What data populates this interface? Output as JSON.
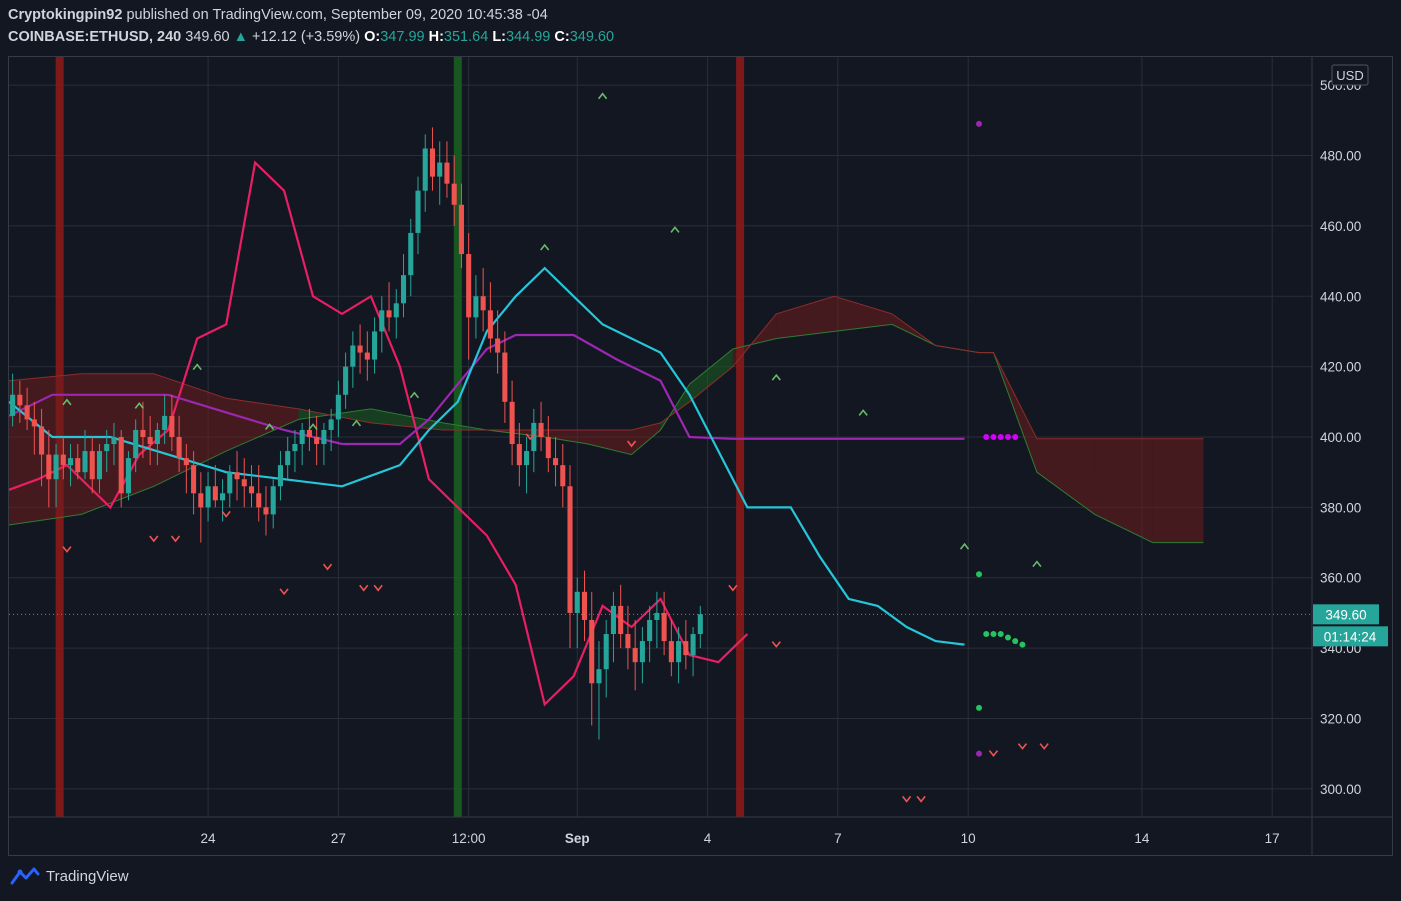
{
  "header": {
    "author": "Cryptokingpin92",
    "published_text": "published on TradingView.com, September 09, 2020 10:45:38 -04",
    "symbol": "COINBASE:ETHUSD, 240",
    "last": "349.60",
    "arrow": "▲",
    "change": "+12.12 (+3.59%)",
    "o_label": "O:",
    "o_value": "347.99",
    "h_label": "H:",
    "h_value": "351.64",
    "l_label": "L:",
    "l_value": "344.99",
    "c_label": "C:",
    "c_value": "349.60"
  },
  "footer": {
    "brand": "TradingView",
    "logo_icon": "tradingview-logo-icon"
  },
  "colors": {
    "background": "#131722",
    "grid": "#2a2e39",
    "up": "#26a69a",
    "down": "#ef5350",
    "tenkan": "#26c6da",
    "kijun": "#9c27b0",
    "chikou": "#e91e63",
    "cloud_bull": "#1b5e20",
    "cloud_bear": "#6d1d1d"
  },
  "chart_data": {
    "type": "candlestick",
    "currency": "USD",
    "y_ticks": [
      "300.00",
      "320.00",
      "340.00",
      "360.00",
      "380.00",
      "400.00",
      "420.00",
      "440.00",
      "460.00",
      "480.00",
      "500.00"
    ],
    "y_range": [
      292,
      508
    ],
    "x_ticks": [
      {
        "label": "24",
        "idx": 27.5
      },
      {
        "label": "27",
        "idx": 45.5
      },
      {
        "label": "12:00",
        "idx": 63.5
      },
      {
        "label": "Sep",
        "idx": 78.5
      },
      {
        "label": "4",
        "idx": 96.5
      },
      {
        "label": "7",
        "idx": 114.5
      },
      {
        "label": "10",
        "idx": 132.5
      },
      {
        "label": "14",
        "idx": 156.5
      },
      {
        "label": "17",
        "idx": 174.5
      }
    ],
    "last_price": {
      "value": 349.6,
      "label": "349.60",
      "countdown": "01:14:24"
    },
    "x_count": 180,
    "candles": [
      [
        406,
        418,
        403,
        412
      ],
      [
        412,
        416,
        404,
        409
      ],
      [
        409,
        414,
        402,
        405
      ],
      [
        405,
        410,
        395,
        403
      ],
      [
        403,
        408,
        386,
        395
      ],
      [
        395,
        402,
        380,
        388
      ],
      [
        388,
        398,
        380,
        395
      ],
      [
        395,
        400,
        388,
        392
      ],
      [
        392,
        398,
        386,
        394
      ],
      [
        394,
        398,
        388,
        390
      ],
      [
        390,
        402,
        388,
        396
      ],
      [
        396,
        400,
        384,
        388
      ],
      [
        388,
        398,
        384,
        396
      ],
      [
        396,
        402,
        390,
        398
      ],
      [
        398,
        404,
        392,
        400
      ],
      [
        400,
        402,
        380,
        384
      ],
      [
        384,
        396,
        382,
        394
      ],
      [
        394,
        405,
        390,
        402
      ],
      [
        402,
        410,
        394,
        400
      ],
      [
        400,
        406,
        392,
        398
      ],
      [
        398,
        404,
        392,
        402
      ],
      [
        402,
        412,
        398,
        406
      ],
      [
        406,
        412,
        396,
        400
      ],
      [
        400,
        406,
        390,
        394
      ],
      [
        394,
        398,
        384,
        392
      ],
      [
        392,
        396,
        378,
        384
      ],
      [
        384,
        390,
        370,
        380
      ],
      [
        380,
        390,
        376,
        386
      ],
      [
        386,
        392,
        380,
        382
      ],
      [
        382,
        388,
        376,
        384
      ],
      [
        384,
        392,
        380,
        390
      ],
      [
        390,
        396,
        382,
        388
      ],
      [
        388,
        394,
        380,
        386
      ],
      [
        386,
        392,
        380,
        384
      ],
      [
        384,
        392,
        376,
        380
      ],
      [
        380,
        386,
        372,
        378
      ],
      [
        378,
        388,
        374,
        386
      ],
      [
        386,
        396,
        382,
        392
      ],
      [
        392,
        400,
        388,
        396
      ],
      [
        396,
        402,
        390,
        398
      ],
      [
        398,
        404,
        392,
        402
      ],
      [
        402,
        408,
        396,
        400
      ],
      [
        400,
        406,
        392,
        398
      ],
      [
        398,
        404,
        392,
        402
      ],
      [
        402,
        408,
        396,
        405
      ],
      [
        405,
        416,
        400,
        412
      ],
      [
        412,
        424,
        408,
        420
      ],
      [
        420,
        430,
        414,
        426
      ],
      [
        426,
        432,
        418,
        424
      ],
      [
        424,
        430,
        416,
        422
      ],
      [
        422,
        434,
        418,
        430
      ],
      [
        430,
        440,
        424,
        436
      ],
      [
        436,
        444,
        430,
        434
      ],
      [
        434,
        442,
        428,
        438
      ],
      [
        438,
        452,
        434,
        446
      ],
      [
        446,
        462,
        440,
        458
      ],
      [
        458,
        474,
        452,
        470
      ],
      [
        470,
        486,
        464,
        482
      ],
      [
        482,
        488,
        470,
        474
      ],
      [
        474,
        484,
        466,
        478
      ],
      [
        478,
        484,
        468,
        472
      ],
      [
        472,
        480,
        460,
        466
      ],
      [
        466,
        472,
        448,
        452
      ],
      [
        452,
        458,
        422,
        434
      ],
      [
        434,
        446,
        428,
        440
      ],
      [
        440,
        448,
        430,
        436
      ],
      [
        436,
        444,
        424,
        428
      ],
      [
        428,
        436,
        418,
        424
      ],
      [
        424,
        430,
        404,
        410
      ],
      [
        410,
        416,
        392,
        398
      ],
      [
        398,
        404,
        386,
        392
      ],
      [
        392,
        400,
        384,
        396
      ],
      [
        396,
        408,
        390,
        404
      ],
      [
        404,
        410,
        396,
        400
      ],
      [
        400,
        406,
        390,
        394
      ],
      [
        394,
        400,
        386,
        392
      ],
      [
        392,
        398,
        380,
        386
      ],
      [
        386,
        392,
        340,
        350
      ],
      [
        350,
        360,
        340,
        356
      ],
      [
        356,
        362,
        342,
        348
      ],
      [
        348,
        356,
        318,
        330
      ],
      [
        330,
        342,
        314,
        334
      ],
      [
        334,
        348,
        326,
        344
      ],
      [
        344,
        356,
        336,
        352
      ],
      [
        352,
        358,
        340,
        344
      ],
      [
        344,
        352,
        334,
        340
      ],
      [
        340,
        348,
        328,
        336
      ],
      [
        336,
        346,
        330,
        342
      ],
      [
        342,
        352,
        336,
        348
      ],
      [
        348,
        356,
        340,
        350
      ],
      [
        350,
        356,
        338,
        342
      ],
      [
        342,
        348,
        332,
        336
      ],
      [
        336,
        346,
        330,
        342
      ],
      [
        342,
        348,
        334,
        338
      ],
      [
        338,
        346,
        332,
        344
      ],
      [
        344,
        352,
        340,
        349.6
      ]
    ],
    "candle_x": [
      0.5,
      1.5,
      2.5,
      3.5,
      4.5,
      5.5,
      6.5,
      7.5,
      8.5,
      9.5,
      10.5,
      11.5,
      12.5,
      13.5,
      14.5,
      15.5,
      16.5,
      17.5,
      18.5,
      19.5,
      20.5,
      21.5,
      22.5,
      23.5,
      24.5,
      25.5,
      26.5,
      27.5,
      28.5,
      29.5,
      30.5,
      31.5,
      32.5,
      33.5,
      34.5,
      35.5,
      36.5,
      37.5,
      38.5,
      39.5,
      40.5,
      41.5,
      42.5,
      43.5,
      44.5,
      45.5,
      46.5,
      47.5,
      48.5,
      49.5,
      50.5,
      51.5,
      52.5,
      53.5,
      54.5,
      55.5,
      56.5,
      57.5,
      58.5,
      59.5,
      60.5,
      61.5,
      62.5,
      63.5,
      64.5,
      65.5,
      66.5,
      67.5,
      68.5,
      69.5,
      70.5,
      71.5,
      72.5,
      73.5,
      74.5,
      75.5,
      76.5,
      77.5,
      78.5,
      79.5,
      80.5,
      81.5,
      82.5,
      83.5,
      84.5,
      85.5,
      86.5,
      87.5,
      88.5,
      89.5,
      90.5,
      91.5,
      92.5,
      93.5,
      94.5,
      95.5
    ],
    "tenkan": [
      [
        0,
        410
      ],
      [
        6,
        400
      ],
      [
        14,
        400
      ],
      [
        22,
        395
      ],
      [
        30,
        390
      ],
      [
        38,
        388
      ],
      [
        46,
        386
      ],
      [
        54,
        392
      ],
      [
        58,
        402
      ],
      [
        62,
        410
      ],
      [
        66,
        430
      ],
      [
        70,
        440
      ],
      [
        74,
        448
      ],
      [
        78,
        440
      ],
      [
        82,
        432
      ],
      [
        86,
        428
      ],
      [
        90,
        424
      ],
      [
        94,
        412
      ],
      [
        98,
        396
      ],
      [
        102,
        380
      ],
      [
        108,
        380
      ],
      [
        112,
        366
      ],
      [
        116,
        354
      ],
      [
        120,
        352
      ],
      [
        124,
        346
      ],
      [
        128,
        342
      ],
      [
        132,
        341
      ]
    ],
    "kijun": [
      [
        0,
        406
      ],
      [
        6,
        412
      ],
      [
        14,
        412
      ],
      [
        22,
        412
      ],
      [
        30,
        407
      ],
      [
        38,
        402
      ],
      [
        46,
        398
      ],
      [
        54,
        398
      ],
      [
        58,
        405
      ],
      [
        62,
        415
      ],
      [
        66,
        425
      ],
      [
        70,
        429
      ],
      [
        78,
        429
      ],
      [
        84,
        422
      ],
      [
        90,
        416
      ],
      [
        94,
        400
      ],
      [
        100,
        399.5
      ],
      [
        132,
        399.5
      ]
    ],
    "chikou": [
      [
        0,
        385
      ],
      [
        4,
        388
      ],
      [
        8,
        392
      ],
      [
        14,
        380
      ],
      [
        18,
        395
      ],
      [
        22,
        402
      ],
      [
        26,
        428
      ],
      [
        30,
        432
      ],
      [
        34,
        478
      ],
      [
        38,
        470
      ],
      [
        42,
        440
      ],
      [
        46,
        435
      ],
      [
        50,
        440
      ],
      [
        54,
        420
      ],
      [
        58,
        388
      ],
      [
        62,
        380
      ],
      [
        66,
        372
      ],
      [
        70,
        358
      ],
      [
        74,
        324
      ],
      [
        78,
        332
      ],
      [
        82,
        352
      ],
      [
        86,
        346
      ],
      [
        90,
        354
      ],
      [
        94,
        338
      ],
      [
        98,
        336
      ],
      [
        102,
        344
      ]
    ],
    "cloud_span_a": [
      [
        0,
        375
      ],
      [
        10,
        378
      ],
      [
        20,
        386
      ],
      [
        30,
        396
      ],
      [
        40,
        405
      ],
      [
        50,
        408
      ],
      [
        60,
        404
      ],
      [
        66,
        402
      ],
      [
        74,
        400
      ],
      [
        80,
        398
      ],
      [
        86,
        395
      ],
      [
        90,
        402
      ],
      [
        94,
        415
      ],
      [
        100,
        425
      ],
      [
        106,
        428
      ],
      [
        114,
        430
      ],
      [
        122,
        432
      ],
      [
        128,
        426
      ],
      [
        134,
        424
      ],
      [
        136,
        424
      ],
      [
        142,
        390
      ],
      [
        150,
        378
      ],
      [
        158,
        370
      ],
      [
        165,
        370
      ]
    ],
    "cloud_span_b": [
      [
        0,
        416
      ],
      [
        10,
        418
      ],
      [
        20,
        418
      ],
      [
        30,
        411
      ],
      [
        40,
        408
      ],
      [
        50,
        404
      ],
      [
        60,
        402
      ],
      [
        66,
        402
      ],
      [
        74,
        402
      ],
      [
        80,
        402
      ],
      [
        86,
        402
      ],
      [
        90,
        404
      ],
      [
        94,
        410
      ],
      [
        100,
        420
      ],
      [
        106,
        435
      ],
      [
        114,
        440
      ],
      [
        122,
        435
      ],
      [
        128,
        426
      ],
      [
        134,
        424
      ],
      [
        136,
        424
      ],
      [
        142,
        399.5
      ],
      [
        150,
        399.5
      ],
      [
        158,
        399.5
      ],
      [
        165,
        399.5
      ]
    ],
    "buy_markers": [
      [
        8,
        410
      ],
      [
        18,
        409
      ],
      [
        26,
        420
      ],
      [
        36,
        403
      ],
      [
        42,
        403
      ],
      [
        48,
        404
      ],
      [
        56,
        412
      ],
      [
        74,
        454
      ],
      [
        82,
        497
      ],
      [
        92,
        459
      ],
      [
        106,
        417
      ],
      [
        118,
        407
      ],
      [
        132,
        369
      ],
      [
        142,
        364
      ]
    ],
    "sell_markers": [
      [
        8,
        368
      ],
      [
        20,
        371
      ],
      [
        23,
        371
      ],
      [
        30,
        378
      ],
      [
        38,
        356
      ],
      [
        44,
        363
      ],
      [
        49,
        357
      ],
      [
        51,
        357
      ],
      [
        72,
        400
      ],
      [
        86,
        398
      ],
      [
        100,
        357
      ],
      [
        106,
        341
      ],
      [
        124,
        297
      ],
      [
        126,
        297
      ],
      [
        136,
        310
      ],
      [
        140,
        312
      ],
      [
        143,
        312
      ]
    ],
    "vertical_bands": [
      {
        "idx": 7,
        "color": "#8b1a1a"
      },
      {
        "idx": 62,
        "color": "#1b5e20"
      },
      {
        "idx": 101,
        "color": "#8b1a1a"
      }
    ],
    "psar_dots": [
      [
        134,
        489
      ],
      [
        134,
        361
      ],
      [
        134,
        323
      ],
      [
        134,
        310
      ]
    ],
    "projection_dots": [
      [
        135,
        400
      ],
      [
        136,
        400
      ],
      [
        137,
        400
      ],
      [
        138,
        400
      ],
      [
        139,
        400
      ],
      [
        135,
        344
      ],
      [
        136,
        344
      ],
      [
        137,
        344
      ],
      [
        138,
        343
      ],
      [
        139,
        342
      ],
      [
        140,
        341
      ]
    ]
  }
}
